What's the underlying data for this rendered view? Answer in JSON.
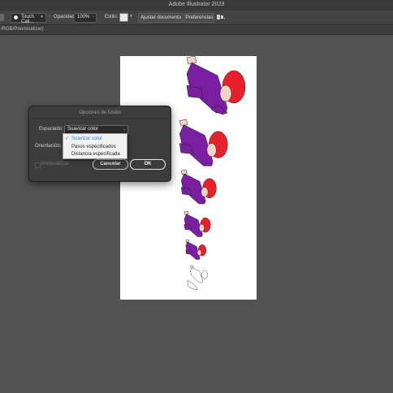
{
  "app": {
    "title": "Adobe Illustrator 2023"
  },
  "control_bar": {
    "brush_name": "Touch Cali...",
    "opacity_label": "Opacidad:",
    "opacity_value": "100%",
    "style_label": "Estilo:",
    "fit_document_button": "Ajustar documento",
    "preferences_button": "Preferencias"
  },
  "document_tab": {
    "label": "/RGB/Previsualizar)"
  },
  "dialog": {
    "title": "Opciones de fusión",
    "spacing_label": "Espaciado:",
    "spacing_value": "Suavizar color",
    "orientation_label": "Orientación:",
    "preview_label": "Previsualizar",
    "preview_checked": false,
    "cancel_button": "Cancelar",
    "ok_button": "OK"
  },
  "spacing_menu": {
    "options": [
      "Suavizar color",
      "Pasos especificados",
      "Distancia especificada"
    ],
    "selected": "Suavizar color"
  },
  "colors": {
    "figure_body": "#7a1fa2",
    "figure_hair": "#e8202a",
    "skin": "#f3d3c3"
  }
}
